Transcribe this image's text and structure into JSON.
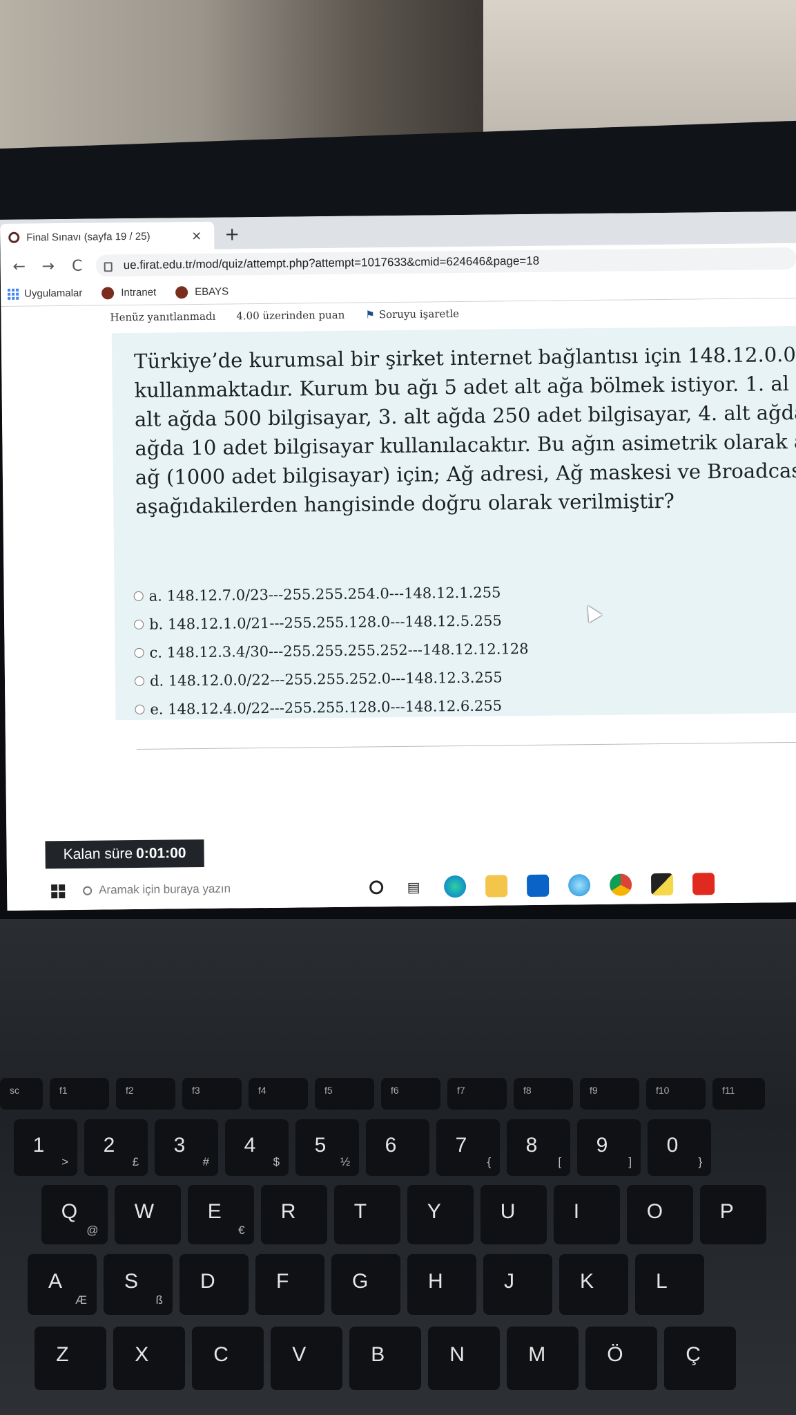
{
  "browser": {
    "tab_title": "Final Sınavı (sayfa 19 / 25)",
    "tab_close": "×",
    "new_tab": "+",
    "back": "←",
    "forward": "→",
    "reload": "C",
    "url": "ue.firat.edu.tr/mod/quiz/attempt.php?attempt=1017633&cmid=624646&page=18",
    "bookmarks": [
      "Uygulamalar",
      "Intranet",
      "EBAYS"
    ]
  },
  "question": {
    "status": "Henüz yanıtlanmadı",
    "points": "4.00 üzerinden puan",
    "flag_label": "Soruyu işaretle",
    "text_lines": [
      "Türkiye’de kurumsal bir şirket internet bağlantısı için 148.12.0.0",
      "kullanmaktadır. Kurum bu ağı 5 adet alt ağa bölmek istiyor. 1. al",
      "alt ağda 500 bilgisayar, 3. alt ağda 250 adet bilgisayar, 4. alt ağda",
      "ağda 10 adet bilgisayar kullanılacaktır. Bu ağın asimetrik olarak a",
      "ağ (1000 adet bilgisayar) için; Ağ adresi, Ağ maskesi ve Broadcas",
      "aşağıdakilerden hangisinde doğru olarak verilmiştir?"
    ],
    "options": [
      "a. 148.12.7.0/23---255.255.254.0---148.12.1.255",
      "b. 148.12.1.0/21---255.255.128.0---148.12.5.255",
      "c. 148.12.3.4/30---255.255.255.252---148.12.12.128",
      "d. 148.12.0.0/22---255.255.252.0---148.12.3.255",
      "e. 148.12.4.0/22---255.255.128.0---148.12.6.255"
    ]
  },
  "timer": {
    "label": "Kalan süre",
    "value": "0:01:00"
  },
  "taskbar": {
    "search_placeholder": "Aramak için buraya yazın",
    "icons": [
      "cortana-icon",
      "task-view-icon",
      "edge-icon",
      "file-explorer-icon",
      "mail-icon",
      "ie-icon",
      "chrome-icon",
      "sticky-notes-icon",
      "acrobat-icon"
    ]
  },
  "keyboard": {
    "function_row": [
      "sc",
      "f1",
      "f2",
      "f3",
      "f4",
      "f5",
      "f6",
      "f7",
      "f8",
      "f9",
      "f10",
      "f11"
    ],
    "number_row": [
      {
        "main": "1",
        "sub": ">"
      },
      {
        "main": "2",
        "sub": "£"
      },
      {
        "main": "3",
        "sub": "#"
      },
      {
        "main": "4",
        "sub": "$"
      },
      {
        "main": "5",
        "sub": "½"
      },
      {
        "main": "6",
        "sub": ""
      },
      {
        "main": "7",
        "sub": "{"
      },
      {
        "main": "8",
        "sub": "["
      },
      {
        "main": "9",
        "sub": "]"
      },
      {
        "main": "0",
        "sub": "}"
      }
    ],
    "q_row": [
      {
        "main": "Q",
        "sub": "@"
      },
      {
        "main": "W",
        "sub": ""
      },
      {
        "main": "E",
        "sub": "€"
      },
      {
        "main": "R",
        "sub": ""
      },
      {
        "main": "T",
        "sub": ""
      },
      {
        "main": "Y",
        "sub": ""
      },
      {
        "main": "U",
        "sub": ""
      },
      {
        "main": "I",
        "sub": ""
      },
      {
        "main": "O",
        "sub": ""
      },
      {
        "main": "P",
        "sub": ""
      }
    ],
    "a_row": [
      {
        "main": "A",
        "sub": "Æ"
      },
      {
        "main": "S",
        "sub": "ß"
      },
      {
        "main": "D",
        "sub": ""
      },
      {
        "main": "F",
        "sub": ""
      },
      {
        "main": "G",
        "sub": ""
      },
      {
        "main": "H",
        "sub": ""
      },
      {
        "main": "J",
        "sub": ""
      },
      {
        "main": "K",
        "sub": ""
      },
      {
        "main": "L",
        "sub": ""
      }
    ],
    "z_row": [
      {
        "main": "Z",
        "sub": ""
      },
      {
        "main": "X",
        "sub": ""
      },
      {
        "main": "C",
        "sub": ""
      },
      {
        "main": "V",
        "sub": ""
      },
      {
        "main": "B",
        "sub": ""
      },
      {
        "main": "N",
        "sub": ""
      },
      {
        "main": "M",
        "sub": ""
      },
      {
        "main": "Ö",
        "sub": ""
      },
      {
        "main": "Ç",
        "sub": ""
      }
    ]
  }
}
